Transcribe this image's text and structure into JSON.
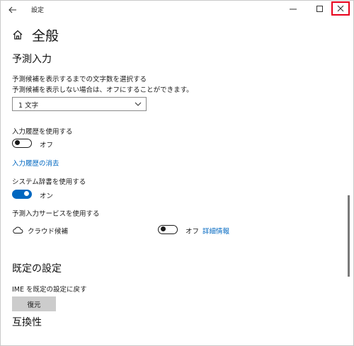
{
  "window": {
    "title": "設定"
  },
  "page": {
    "title": "全般"
  },
  "prediction": {
    "heading": "予測入力",
    "desc_line1": "予測候補を表示するまでの文字数を選択する",
    "desc_line2": "予測候補を表示しない場合は、オフにすることができます。",
    "char_count_selected": "1 文字"
  },
  "history": {
    "label": "入力履歴を使用する",
    "state": "オフ",
    "clear_link": "入力履歴の消去"
  },
  "system_dict": {
    "label": "システム辞書を使用する",
    "state": "オン"
  },
  "prediction_service": {
    "label": "予測入力サービスを使用する",
    "cloud_label": "クラウド候補",
    "state": "オフ",
    "details_link": "詳細情報"
  },
  "defaults": {
    "heading": "既定の設定",
    "reset_label": "IME を既定の設定に戻す",
    "restore_button": "復元"
  },
  "compat": {
    "heading": "互換性"
  },
  "colors": {
    "accent": "#0067c0",
    "close_highlight": "#e8001c"
  },
  "icons": [
    "back-arrow-icon",
    "minimize-icon",
    "maximize-icon",
    "close-icon",
    "home-icon",
    "chevron-down-icon",
    "cloud-icon"
  ]
}
